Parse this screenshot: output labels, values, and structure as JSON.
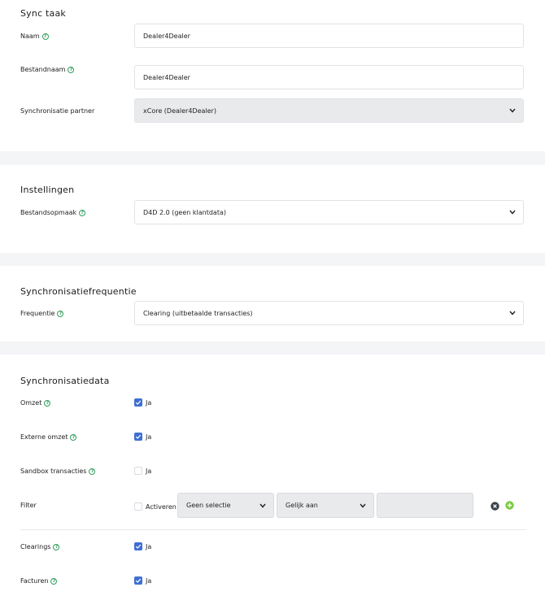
{
  "sync_task": {
    "title": "Sync taak",
    "name_label": "Naam",
    "name_value": "Dealer4Dealer",
    "filename_label": "Bestandnaam",
    "filename_value": "Dealer4Dealer",
    "partner_label": "Synchronisatie partner",
    "partner_value": "xCore (Dealer4Dealer)"
  },
  "settings": {
    "title": "Instellingen",
    "format_label": "Bestandsopmaak",
    "format_value": "D4D 2.0 (geen klantdata)"
  },
  "frequency": {
    "title": "Synchronisatiefrequentie",
    "freq_label": "Frequentie",
    "freq_value": "Clearing (uitbetaalde transacties)"
  },
  "sync_data": {
    "title": "Synchronisatiedata",
    "rows": [
      {
        "label": "Omzet",
        "checked": true,
        "text": "Ja"
      },
      {
        "label": "Externe omzet",
        "checked": true,
        "text": "Ja"
      },
      {
        "label": "Sandbox transacties",
        "checked": false,
        "text": "Ja"
      }
    ],
    "filter": {
      "label": "Filter",
      "activate_label": "Activeren",
      "activate_checked": false,
      "selection_value": "Geen selectie",
      "operator_value": "Gelijk aan",
      "value": ""
    },
    "rows2": [
      {
        "label": "Clearings",
        "checked": true,
        "text": "Ja"
      },
      {
        "label": "Facturen",
        "checked": true,
        "text": "Ja"
      }
    ]
  },
  "colors": {
    "accent_checkbox": "#3e6fd2",
    "help_icon": "#2e9e5b",
    "add_icon": "#7ac943",
    "remove_icon": "#3a3f4a"
  }
}
